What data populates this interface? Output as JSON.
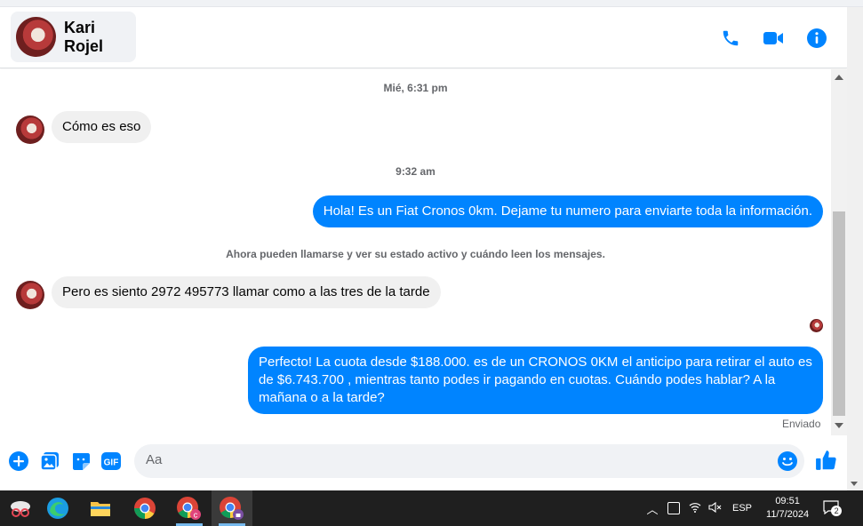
{
  "header": {
    "contact_name": "Kari Rojel",
    "icons": [
      "phone-icon",
      "video-icon",
      "info-icon"
    ],
    "accent": "#0084ff"
  },
  "messages": [
    {
      "type": "timestamp",
      "text": "Mié, 6:31 pm"
    },
    {
      "type": "incoming",
      "text": "Cómo es eso"
    },
    {
      "type": "timestamp",
      "text": "9:32 am"
    },
    {
      "type": "outgoing",
      "text": "Hola! Es un Fiat Cronos 0km. Dejame tu numero  para enviarte toda la información."
    },
    {
      "type": "system",
      "text": "Ahora pueden llamarse y ver su estado activo y cuándo leen los mensajes."
    },
    {
      "type": "incoming",
      "text": "Pero es siento 2972 495773 llamar como a las tres de la tarde"
    },
    {
      "type": "outgoing",
      "text": "Perfecto! La cuota desde $188.000. es de un CRONOS 0KM el anticipo para retirar el auto es de $6.743.700 , mientras tanto podes ir pagando en cuotas. Cuándo podes hablar? A la mañana o a la tarde?"
    }
  ],
  "status": "Enviado",
  "composer": {
    "placeholder": "Aa",
    "icons": [
      "plus-icon",
      "gallery-icon",
      "sticker-icon",
      "gif-icon",
      "emoji-icon",
      "like-icon"
    ],
    "gif_label": "GIF"
  },
  "taskbar": {
    "apps": [
      "snipping-tool-icon",
      "edge-icon",
      "file-explorer-icon",
      "chrome-icon",
      "chrome-profile-c-icon",
      "chrome-profile-lock-icon"
    ],
    "language": "ESP",
    "time": "09:51",
    "date": "11/7/2024",
    "notifications": "2"
  }
}
